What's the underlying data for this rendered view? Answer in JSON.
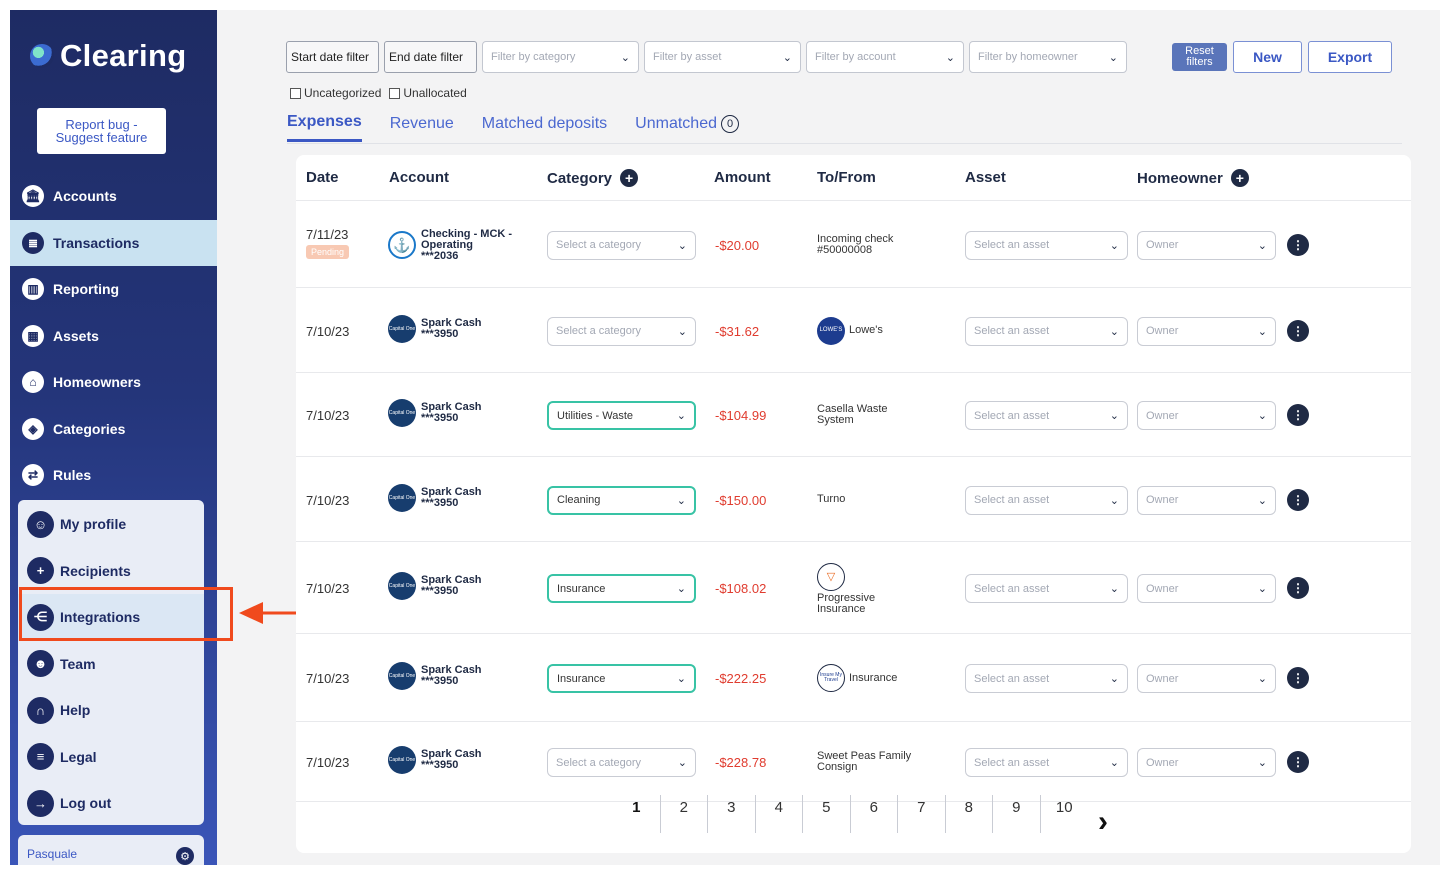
{
  "app": {
    "name": "Clearing",
    "report_label_line1": "Report bug -",
    "report_label_line2": "Suggest feature"
  },
  "nav": [
    {
      "label": "Accounts",
      "icon": "bank-icon"
    },
    {
      "label": "Transactions",
      "icon": "ledger-icon",
      "active": true
    },
    {
      "label": "Reporting",
      "icon": "bar-chart-icon"
    },
    {
      "label": "Assets",
      "icon": "building-icon"
    },
    {
      "label": "Homeowners",
      "icon": "house-icon"
    },
    {
      "label": "Categories",
      "icon": "tag-icon"
    },
    {
      "label": "Rules",
      "icon": "flow-icon"
    }
  ],
  "secondary_nav": [
    {
      "label": "My profile",
      "icon": "user-icon"
    },
    {
      "label": "Recipients",
      "icon": "user-plus-icon"
    },
    {
      "label": "Integrations",
      "icon": "share-icon",
      "highlighted": true
    },
    {
      "label": "Team",
      "icon": "team-icon"
    },
    {
      "label": "Help",
      "icon": "headset-icon"
    },
    {
      "label": "Legal",
      "icon": "document-icon"
    },
    {
      "label": "Log out",
      "icon": "logout-icon"
    }
  ],
  "user": {
    "name": "Pasquale"
  },
  "filters": {
    "start_date": "Start date filter",
    "end_date": "End date filter",
    "category_placeholder": "Filter by category",
    "asset_placeholder": "Filter by asset",
    "account_placeholder": "Filter by account",
    "homeowner_placeholder": "Filter by homeowner",
    "reset_line1": "Reset",
    "reset_line2": "filters",
    "new_label": "New",
    "export_label": "Export",
    "uncategorized": "Uncategorized",
    "unallocated": "Unallocated"
  },
  "tabs": [
    {
      "label": "Expenses",
      "active": true
    },
    {
      "label": "Revenue"
    },
    {
      "label": "Matched deposits"
    },
    {
      "label": "Unmatched",
      "count": "0"
    }
  ],
  "table": {
    "headers": {
      "date": "Date",
      "account": "Account",
      "category": "Category",
      "amount": "Amount",
      "tofrom": "To/From",
      "asset": "Asset",
      "homeowner": "Homeowner"
    },
    "category_placeholder": "Select a category",
    "asset_placeholder": "Select an asset",
    "owner_placeholder": "Owner",
    "rows": [
      {
        "date": "7/11/23",
        "badge": "Pending",
        "account_line1": "Checking - MCK -",
        "account_line2": "Operating",
        "account_line3": "***2036",
        "account_logo": "anchor-logo-icon",
        "category": "",
        "amount": "-$20.00",
        "tofrom_line1": "Incoming check",
        "tofrom_line2": "#50000008",
        "vendor_logo": ""
      },
      {
        "date": "7/10/23",
        "badge": "",
        "account_line1": "Spark Cash",
        "account_line2": "***3950",
        "account_line3": "",
        "account_logo": "capital-one-logo-icon",
        "category": "",
        "amount": "-$31.62",
        "tofrom_line1": "Lowe's",
        "tofrom_line2": "",
        "vendor_logo": "lowes-logo-icon"
      },
      {
        "date": "7/10/23",
        "badge": "",
        "account_line1": "Spark Cash",
        "account_line2": "***3950",
        "account_line3": "",
        "account_logo": "capital-one-logo-icon",
        "category": "Utilities - Waste",
        "amount": "-$104.99",
        "tofrom_line1": "Casella Waste",
        "tofrom_line2": "System",
        "vendor_logo": ""
      },
      {
        "date": "7/10/23",
        "badge": "",
        "account_line1": "Spark Cash",
        "account_line2": "***3950",
        "account_line3": "",
        "account_logo": "capital-one-logo-icon",
        "category": "Cleaning",
        "amount": "-$150.00",
        "tofrom_line1": "Turno",
        "tofrom_line2": "",
        "vendor_logo": ""
      },
      {
        "date": "7/10/23",
        "badge": "",
        "account_line1": "Spark Cash",
        "account_line2": "***3950",
        "account_line3": "",
        "account_logo": "capital-one-logo-icon",
        "category": "Insurance",
        "amount": "-$108.02",
        "tofrom_line1": "Progressive",
        "tofrom_line2": "Insurance",
        "vendor_logo": "progressive-logo-icon"
      },
      {
        "date": "7/10/23",
        "badge": "",
        "account_line1": "Spark Cash",
        "account_line2": "***3950",
        "account_line3": "",
        "account_logo": "capital-one-logo-icon",
        "category": "Insurance",
        "amount": "-$222.25",
        "tofrom_line1": "Insurance",
        "tofrom_line2": "",
        "vendor_logo": "insure-my-travel-logo-icon"
      },
      {
        "date": "7/10/23",
        "badge": "",
        "account_line1": "Spark Cash",
        "account_line2": "***3950",
        "account_line3": "",
        "account_logo": "capital-one-logo-icon",
        "category": "",
        "amount": "-$228.78",
        "tofrom_line1": "Sweet Peas Family",
        "tofrom_line2": "Consign",
        "vendor_logo": ""
      }
    ]
  },
  "pagination": {
    "pages": [
      "1",
      "2",
      "3",
      "4",
      "5",
      "6",
      "7",
      "8",
      "9",
      "10"
    ],
    "current": "1"
  },
  "colors": {
    "sidebar": "#1e2b63",
    "accent": "#3b58c4",
    "callout": "#f04a1d",
    "negative_amount": "#e03c2f",
    "category_set_border": "#38c3a5"
  }
}
